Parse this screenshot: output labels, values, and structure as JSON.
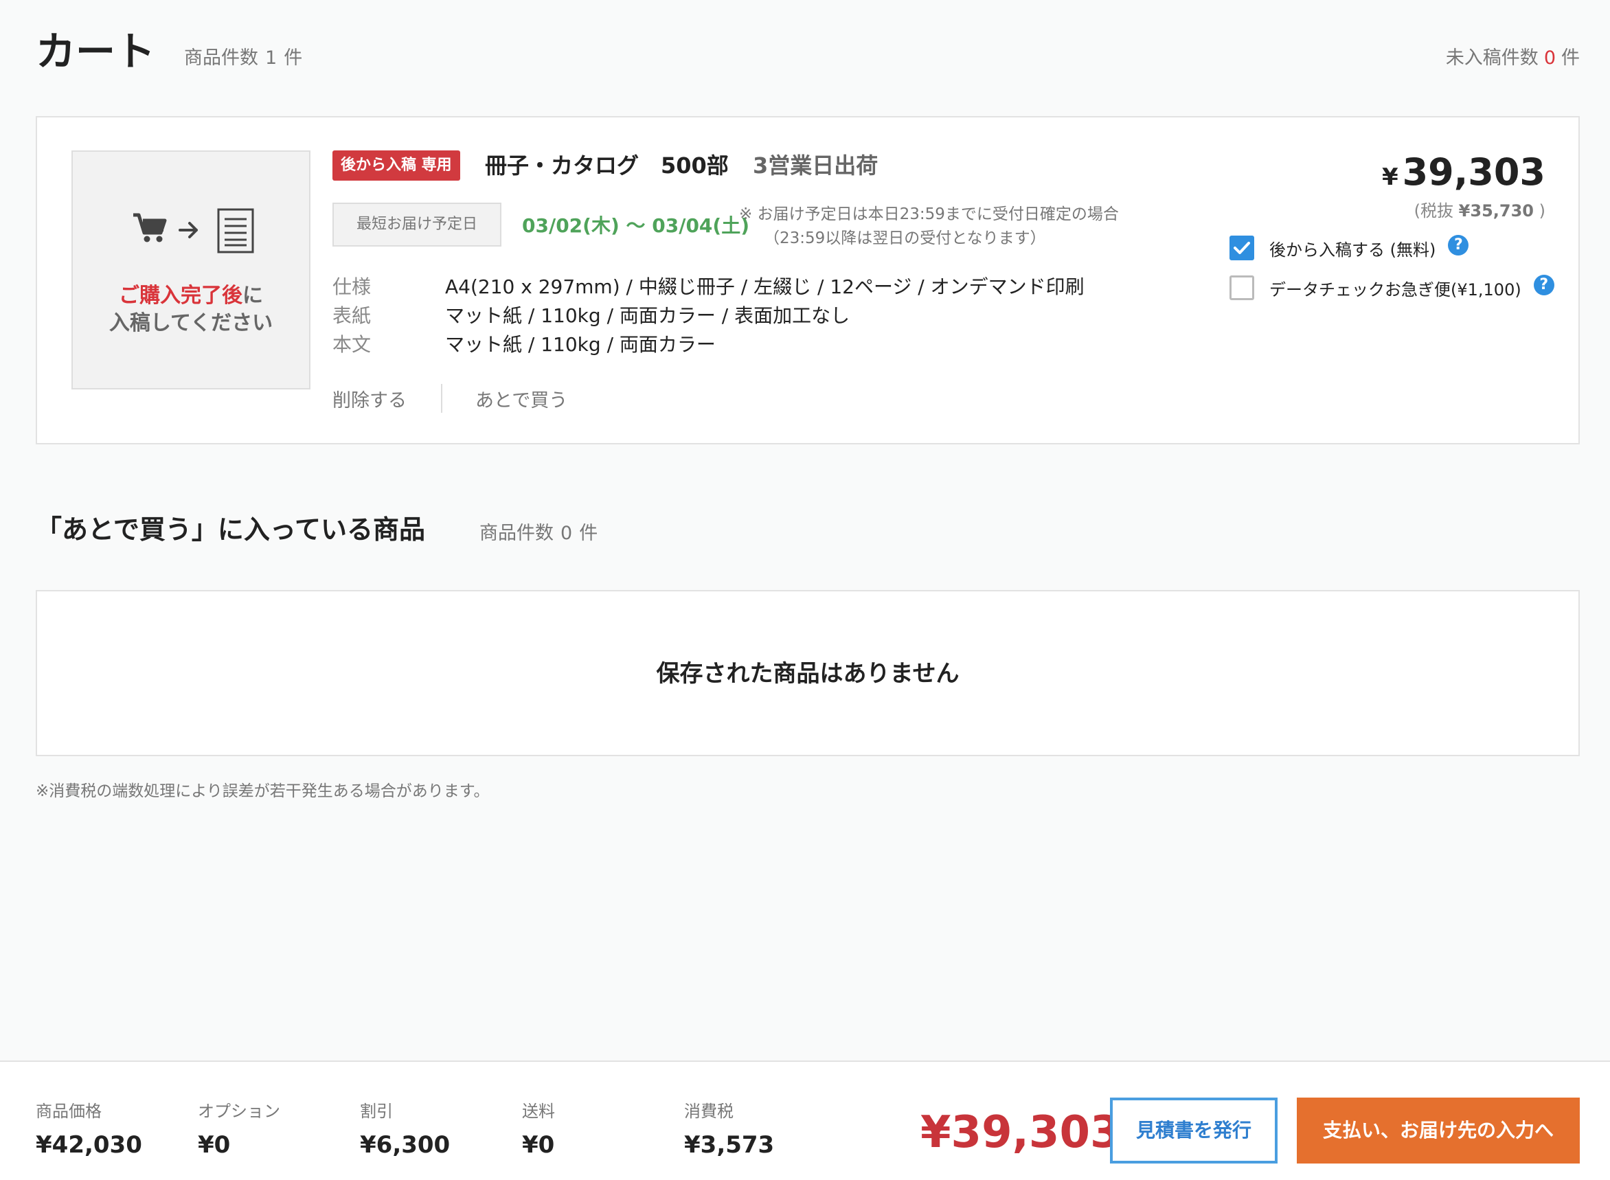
{
  "header": {
    "title": "カート",
    "item_count_label": "商品件数",
    "item_count": "1",
    "item_count_unit": "件",
    "unsubmitted_label": "未入稿件数",
    "unsubmitted_count": "0",
    "unsubmitted_unit": "件"
  },
  "cart_item": {
    "thumb_text_red": "ご購入完了後",
    "thumb_text_suffix": "に",
    "thumb_text_line2": "入稿してください",
    "badge": "後から入稿 専用",
    "name": "冊子・カタログ",
    "quantity": "500部",
    "shipping": "3営業日出荷",
    "delivery_label": "最短お届け予定日",
    "delivery_date": "03/02(木) 〜 03/04(土)",
    "delivery_note_line1": "※ お届け予定日は本日23:59までに受付日確定の場合",
    "delivery_note_line2": "（23:59以降は翌日の受付となります）",
    "specs": [
      {
        "label": "仕様",
        "value": "A4(210 x 297mm) / 中綴じ冊子 / 左綴じ / 12ページ / オンデマンド印刷"
      },
      {
        "label": "表紙",
        "value": "マット紙 / 110kg / 両面カラー / 表面加工なし"
      },
      {
        "label": "本文",
        "value": "マット紙 / 110kg / 両面カラー"
      }
    ],
    "delete_label": "削除する",
    "save_later_label": "あとで買う",
    "price_symbol": "¥",
    "price": "39,303",
    "price_note_prefix": "(税抜",
    "price_excl_tax": "¥35,730",
    "price_note_suffix": ")",
    "options": [
      {
        "label": "後から入稿する (無料)",
        "checked": true
      },
      {
        "label": "データチェックお急ぎ便(¥1,100)",
        "checked": false
      }
    ]
  },
  "save_later": {
    "title": "「あとで買う」に入っている商品",
    "count_label": "商品件数",
    "count": "0",
    "count_unit": "件",
    "empty_message": "保存された商品はありません"
  },
  "tax_note": "※消費税の端数処理により誤差が若干発生ある場合があります。",
  "footer": {
    "summary": [
      {
        "label": "商品価格",
        "value": "¥42,030"
      },
      {
        "label": "オプション",
        "value": "¥0"
      },
      {
        "label": "割引",
        "value": "¥6,300"
      },
      {
        "label": "送料",
        "value": "¥0"
      },
      {
        "label": "消費税",
        "value": "¥3,573"
      }
    ],
    "total": "¥39,303",
    "quote_button": "見積書を発行",
    "checkout_button": "支払い、お届け先の入力へ"
  },
  "colors": {
    "accent_red": "#d13a3f",
    "delivery_green": "#4fa35a",
    "checkbox_blue": "#2f8fe0",
    "checkout_orange": "#e5702e"
  }
}
